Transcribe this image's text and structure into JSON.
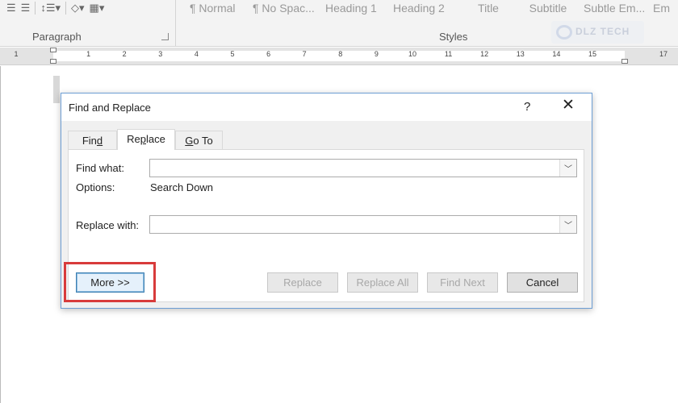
{
  "ribbon": {
    "paragraph_label": "Paragraph",
    "styles_label": "Styles",
    "styles": [
      "¶ Normal",
      "¶ No Spac...",
      "Heading 1",
      "Heading 2",
      "Title",
      "Subtitle",
      "Subtle Em...",
      "Em"
    ],
    "watermark": "DLZ TECH"
  },
  "ruler": {
    "numbers": [
      "1",
      "1",
      "2",
      "3",
      "4",
      "5",
      "6",
      "7",
      "8",
      "9",
      "10",
      "11",
      "12",
      "13",
      "14",
      "15",
      "17"
    ]
  },
  "dialog": {
    "title": "Find and Replace",
    "help": "?",
    "close": "✕",
    "tabs": [
      {
        "label": "Find",
        "underline_index": 3,
        "active": false
      },
      {
        "label": "Replace",
        "underline_index": 2,
        "active": true
      },
      {
        "label": "Go To",
        "underline_index": 0,
        "active": false
      }
    ],
    "find_label": "Find what:",
    "find_value": "",
    "options_label": "Options:",
    "options_value": "Search Down",
    "replace_label": "Replace with:",
    "replace_value": "",
    "buttons": {
      "more": "More >>",
      "replace": "Replace",
      "replace_all": "Replace All",
      "find_next": "Find Next",
      "cancel": "Cancel"
    }
  },
  "colors": {
    "highlight": "#d83b3b",
    "dialog_border": "#6d9ed4"
  }
}
